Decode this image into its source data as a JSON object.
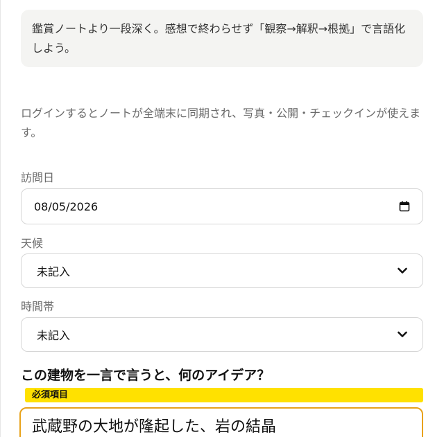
{
  "intro": {
    "text": "鑑賞ノートより一段深く。感想で終わらせず「観察→解釈→根拠」で言語化しよう。"
  },
  "login_note": {
    "text": "ログインするとノートが全端末に同期され、写真・公開・チェックインが使えます。"
  },
  "visit_date": {
    "label": "訪問日",
    "value": "08/05/2026"
  },
  "weather": {
    "label": "天候",
    "selected": "未記入"
  },
  "time_of_day": {
    "label": "時間帯",
    "selected": "未記入"
  },
  "question": {
    "text": "この建物を一言で言うと、何のアイデア？",
    "required_label": "必須項目",
    "answer_value": "武蔵野の大地が隆起した、岩の結晶"
  }
}
